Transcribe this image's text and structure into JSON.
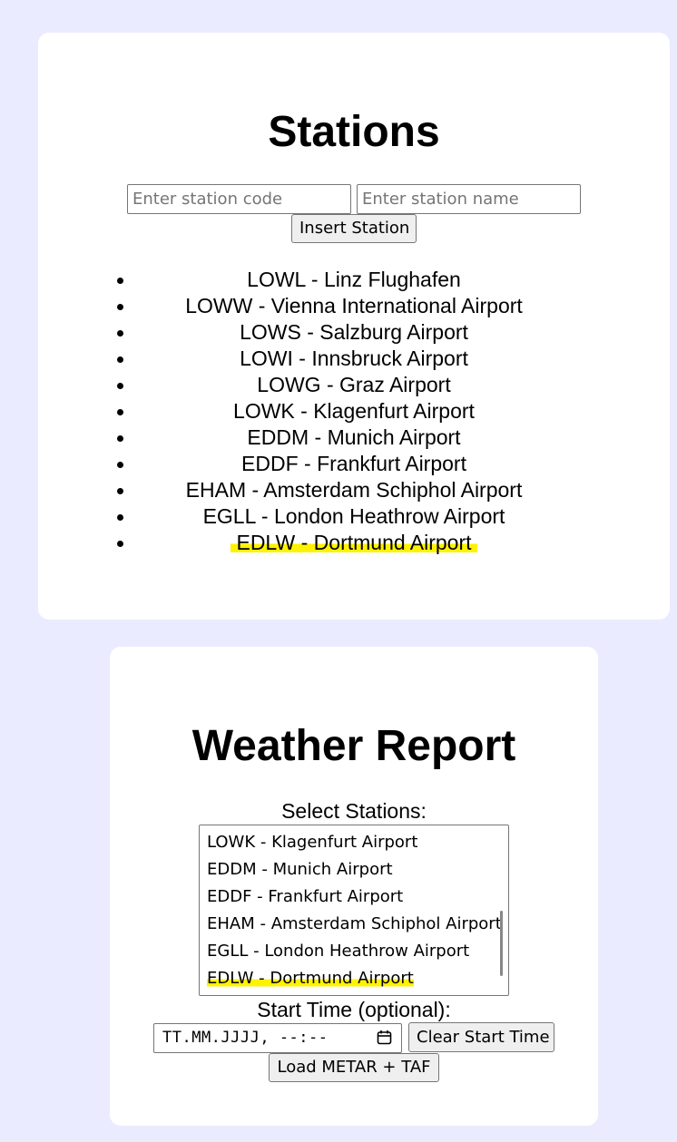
{
  "stations_section": {
    "title": "Stations",
    "code_placeholder": "Enter station code",
    "name_placeholder": "Enter station name",
    "insert_button": "Insert Station",
    "stations": [
      "LOWL - Linz Flughafen",
      "LOWW - Vienna International Airport",
      "LOWS - Salzburg Airport",
      "LOWI - Innsbruck Airport",
      "LOWG - Graz Airport",
      "LOWK - Klagenfurt Airport",
      "EDDM - Munich Airport",
      "EDDF - Frankfurt Airport",
      "EHAM - Amsterdam Schiphol Airport",
      "EGLL - London Heathrow Airport",
      "EDLW - Dortmund Airport"
    ]
  },
  "weather_section": {
    "title": "Weather Report",
    "select_label": "Select Stations:",
    "visible_options": [
      "LOWK - Klagenfurt Airport",
      "EDDM - Munich Airport",
      "EDDF - Frankfurt Airport",
      "EHAM - Amsterdam Schiphol Airport",
      "EGLL - London Heathrow Airport",
      "EDLW - Dortmund Airport"
    ],
    "start_time_label": "Start Time (optional):",
    "start_time_placeholder": "TT.MM.JJJJ, --:--",
    "clear_button": "Clear Start Time",
    "load_button": "Load METAR + TAF"
  },
  "colors": {
    "page_background": "#ebebff",
    "card_background": "#ffffff",
    "highlight": "#fff200"
  }
}
